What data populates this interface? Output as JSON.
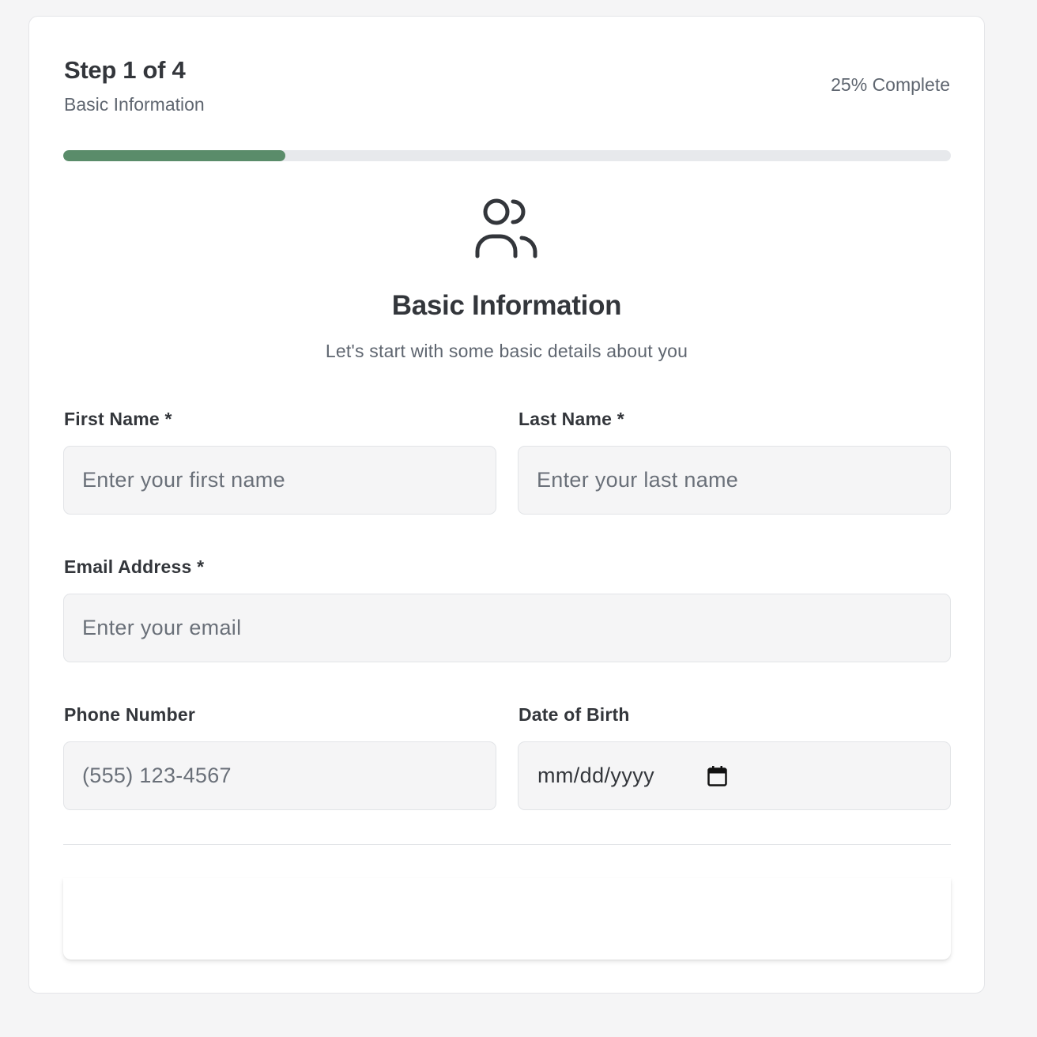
{
  "header": {
    "step": "Step 1 of 4",
    "subtitle": "Basic Information",
    "progress_text": "25% Complete",
    "progress": 0.25,
    "progress_color": "#5a8c6a"
  },
  "section": {
    "icon": "users-icon",
    "title": "Basic Information",
    "description": "Let's start with some basic details about you"
  },
  "fields": {
    "first_name": {
      "label": "First Name *",
      "placeholder": "Enter your first name"
    },
    "last_name": {
      "label": "Last Name *",
      "placeholder": "Enter your last name"
    },
    "email": {
      "label": "Email Address *",
      "placeholder": "Enter your email"
    },
    "phone": {
      "label": "Phone Number",
      "placeholder": "(555) 123-4567"
    },
    "dob": {
      "label": "Date of Birth",
      "placeholder": "mm/dd/yyyy",
      "icon": "calendar-icon"
    }
  }
}
